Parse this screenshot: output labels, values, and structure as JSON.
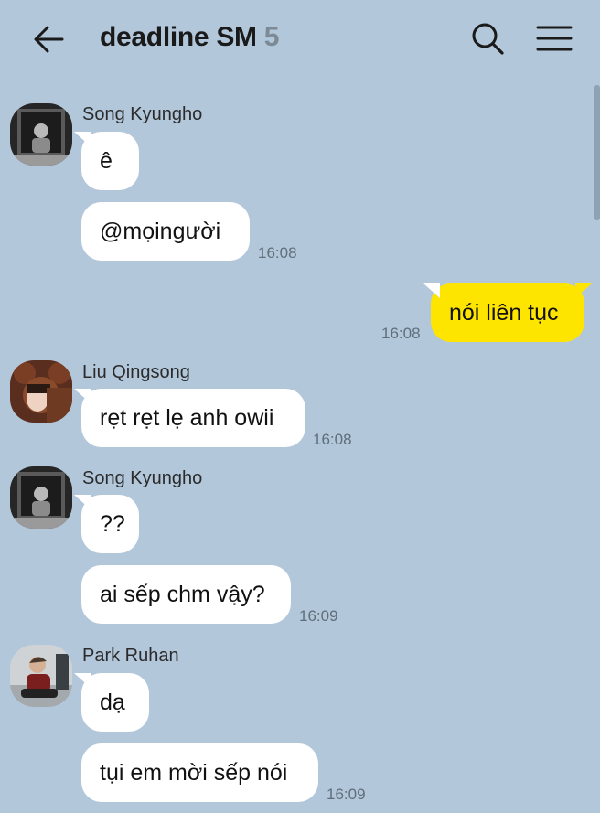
{
  "header": {
    "back_icon": "arrow-left-icon",
    "title": "deadline SM",
    "member_count": "5",
    "search_icon": "search-icon",
    "menu_icon": "hamburger-menu-icon"
  },
  "colors": {
    "background": "#b2c7da",
    "incoming_bubble": "#ffffff",
    "outgoing_bubble": "#fee500",
    "timestamp": "#5f6e7b"
  },
  "messages": [
    {
      "sender": "Song Kyungho",
      "text": "ê",
      "time": ""
    },
    {
      "sender": "Song Kyungho",
      "text": "@mọingười",
      "time": "16:08"
    },
    {
      "sender": "me",
      "text": "nói liên tục",
      "time": "16:08"
    },
    {
      "sender": "Liu Qingsong",
      "text": "rẹt rẹt lẹ anh owii",
      "time": "16:08"
    },
    {
      "sender": "Song Kyungho",
      "text": "??",
      "time": ""
    },
    {
      "sender": "Song Kyungho",
      "text": "ai sếp chm vậy?",
      "time": "16:09"
    },
    {
      "sender": "Park Ruhan",
      "text": "dạ",
      "time": ""
    },
    {
      "sender": "Park Ruhan",
      "text": "tụi em mời sếp nói",
      "time": "16:09"
    }
  ]
}
